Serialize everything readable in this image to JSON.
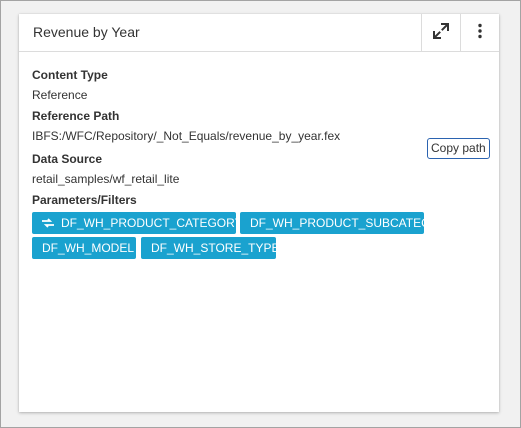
{
  "card": {
    "title": "Revenue by Year",
    "expand_icon": "expand-icon",
    "more_icon": "more-vertical-icon"
  },
  "details": {
    "content_type_label": "Content Type",
    "content_type_value": "Reference",
    "reference_path_label": "Reference Path",
    "reference_path_value": "IBFS:/WFC/Repository/_Not_Equals/revenue_by_year.fex",
    "copy_path_button": "Copy path",
    "data_source_label": "Data Source",
    "data_source_value": "retail_samples/wf_retail_lite",
    "parameters_label": "Parameters/Filters"
  },
  "parameters": [
    {
      "label": "DF_WH_PRODUCT_CATEGORY",
      "icon": "linked-filter-icon"
    },
    {
      "label": "DF_WH_PRODUCT_SUBCATEG",
      "icon": ""
    },
    {
      "label": "DF_WH_MODEL",
      "icon": ""
    },
    {
      "label": "DF_WH_STORE_TYPE",
      "icon": ""
    }
  ],
  "colors": {
    "chip_bg": "#1aa2cf",
    "copy_button_border": "#2b63b0",
    "frame_bg": "#f1f1f1"
  }
}
